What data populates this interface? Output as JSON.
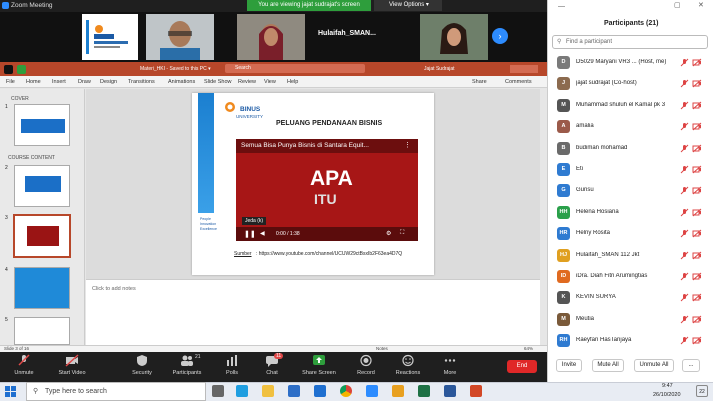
{
  "window": {
    "title": "Zoom Meeting"
  },
  "banner": {
    "viewing": "You are viewing jajat sudrajat's screen",
    "view_options": "View Options ▾"
  },
  "video_tiles": {
    "tile3_name": "Hulaifah_SMAN..."
  },
  "ppt": {
    "filename": "Materi_HKI - Saved to this PC ▾",
    "search_placeholder": "Search",
    "user": "Jajat Sudrajat",
    "share": "Share",
    "comments": "Comments",
    "menu": [
      "File",
      "Home",
      "Insert",
      "Draw",
      "Design",
      "Transitions",
      "Animations",
      "Slide Show",
      "Review",
      "View",
      "Help"
    ],
    "sections": {
      "cover": "COVER",
      "course": "COURSE CONTENT"
    },
    "slide_nums": [
      "1",
      "2",
      "3",
      "4",
      "5"
    ],
    "slide": {
      "logo": "BINUS",
      "logo_sub": "UNIVERSITY",
      "title": "PELUANG PENDANAAN BISNIS",
      "tagline": "People Innovation Excellence",
      "video_title": "Semua Bisa Punya Bisnis di Santara Equit...",
      "video_big1": "APA",
      "video_big2": "ITU",
      "video_pause": "Jeda (k)",
      "video_time": "0:00 / 1:38",
      "source_label": "Sumber",
      "source_url": ": https://www.youtube.com/channel/UCUW29ctBsxIb2F63ea4D7Q"
    },
    "notes_placeholder": "Click to add notes",
    "status_left": "Slide 3 of 16",
    "status_notes": "Notes",
    "zoom": "64%"
  },
  "zoom_toolbar": {
    "unmute": "Unmute",
    "start_video": "Start Video",
    "security": "Security",
    "participants": "Participants",
    "participants_count": "21",
    "polls": "Polls",
    "chat": "Chat",
    "chat_badge": "11",
    "share": "Share Screen",
    "record": "Record",
    "reactions": "Reactions",
    "more": "More",
    "end": "End"
  },
  "panel": {
    "title": "Participants (21)",
    "search_placeholder": "Find a participant",
    "participants": [
      {
        "initials": "D",
        "name": "D5029 Maryani VR3 ... (Host, me)",
        "color": "#7a7a7a"
      },
      {
        "initials": "J",
        "name": "jajat sudrajat (Co-host)",
        "color": "#8c6b4f"
      },
      {
        "initials": "M",
        "name": "Muhammad shuluh el Kamal pk 3",
        "color": "#555"
      },
      {
        "initials": "A",
        "name": "amalia",
        "color": "#9b5a4a"
      },
      {
        "initials": "B",
        "name": "budiman mohamad",
        "color": "#6a6a6a"
      },
      {
        "initials": "E",
        "name": "Eti",
        "color": "#2f7bd1"
      },
      {
        "initials": "G",
        "name": "Gunsu",
        "color": "#2f7bd1"
      },
      {
        "initials": "HH",
        "name": "Helena Hosiana",
        "color": "#2aa04a"
      },
      {
        "initials": "HR",
        "name": "Helny Rosita",
        "color": "#2f7bd1"
      },
      {
        "initials": "HJ",
        "name": "Hulaifah_SMAN 112 Jkt",
        "color": "#e0a020"
      },
      {
        "initials": "ID",
        "name": "iDra. Diah Fitri Arumingtias",
        "color": "#e06a20"
      },
      {
        "initials": "K",
        "name": "KEVIN SURYA",
        "color": "#555"
      },
      {
        "initials": "M",
        "name": "Meutia",
        "color": "#7a5a3a"
      },
      {
        "initials": "RH",
        "name": "Raeyfan HasTanjaya",
        "color": "#2f7bd1"
      }
    ],
    "invite": "Invite",
    "mute_all": "Mute All",
    "unmute_all": "Unmute All",
    "more": "..."
  },
  "taskbar": {
    "search_placeholder": "Type here to search",
    "time": "9:47",
    "date": "26/10/2020",
    "notif": "22"
  },
  "colors": {
    "ppt_red": "#b7472a",
    "zoom_green": "#2e9e3c",
    "end_red": "#e02828",
    "mic_red": "#e04848"
  }
}
